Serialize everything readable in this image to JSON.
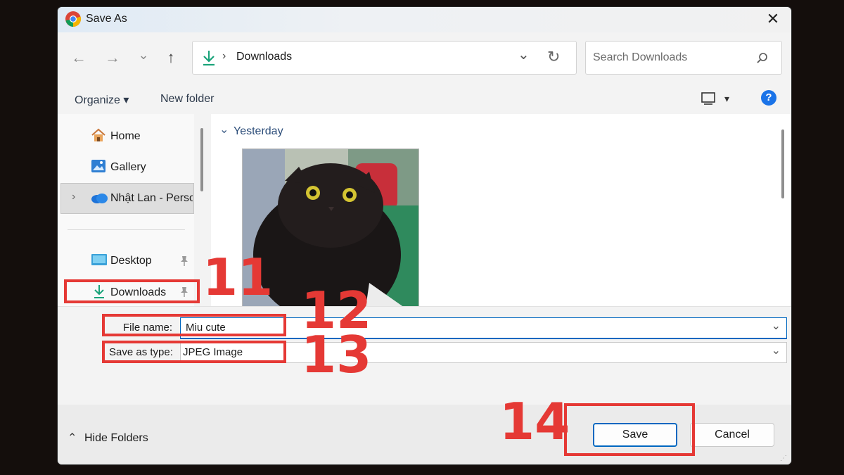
{
  "window": {
    "title": "Save As",
    "close_glyph": "✕"
  },
  "nav_buttons": {
    "back": "←",
    "forward": "→",
    "recent": "⌄",
    "up": "↑"
  },
  "address_bar": {
    "location": "Downloads",
    "separator": "›",
    "dropdown": "⌄",
    "refresh": "↻"
  },
  "search": {
    "placeholder": "Search Downloads"
  },
  "toolbar": {
    "organize": "Organize ▾",
    "new_folder": "New folder",
    "view_dropdown": "▾",
    "help": "?"
  },
  "sidebar": {
    "items": [
      {
        "label": "Home"
      },
      {
        "label": "Gallery"
      },
      {
        "label": "Nhật Lan - Perso",
        "expander": "›"
      },
      {
        "label": "Desktop"
      },
      {
        "label": "Downloads"
      }
    ]
  },
  "content": {
    "group_header": "Yesterday",
    "group_chevron": "⌄"
  },
  "form": {
    "file_name_label": "File name:",
    "file_name_value": "Miu cute",
    "save_type_label": "Save as type:",
    "save_type_value": "JPEG Image",
    "dropdown_glyph": "⌄"
  },
  "footer": {
    "hide_folders": "Hide Folders",
    "hide_glyph": "⌃",
    "save": "Save",
    "cancel": "Cancel"
  },
  "annotations": {
    "n11": "11",
    "n12": "12",
    "n13": "13",
    "n14": "14"
  },
  "colors": {
    "accent_red": "#e53935",
    "accent_blue": "#0067c0"
  }
}
